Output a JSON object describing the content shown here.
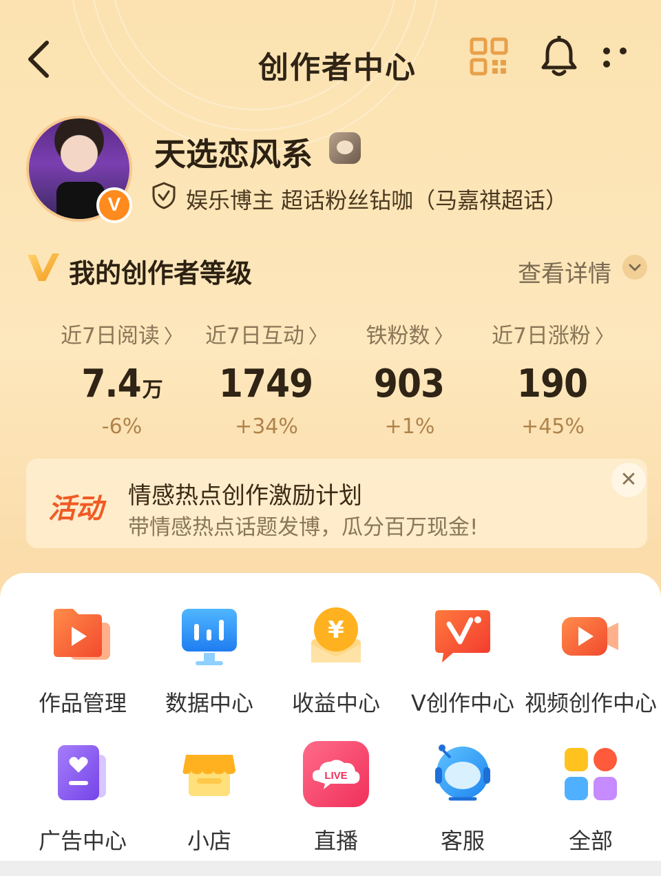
{
  "header": {
    "title": "创作者中心",
    "back_icon": "chevron-left-icon",
    "qr_icon": "qr-code-icon",
    "bell_icon": "bell-icon",
    "more_icon": "more-dots-icon"
  },
  "profile": {
    "name": "天选恋风系",
    "verified_badge": "V",
    "verify_text": "娱乐博主 超话粉丝钻咖（马嘉祺超话）"
  },
  "level": {
    "title": "我的创作者等级",
    "detail_link": "查看详情"
  },
  "stats": [
    {
      "label": "近7日阅读",
      "value": "7.4",
      "unit": "万",
      "change": "-6%"
    },
    {
      "label": "近7日互动",
      "value": "1749",
      "unit": "",
      "change": "+34%"
    },
    {
      "label": "铁粉数",
      "value": "903",
      "unit": "",
      "change": "+1%"
    },
    {
      "label": "近7日涨粉",
      "value": "190",
      "unit": "",
      "change": "+45%"
    }
  ],
  "banner": {
    "tag": "活动",
    "title": "情感热点创作激励计划",
    "subtitle": "带情感热点话题发博，瓜分百万现金!",
    "close": "✕"
  },
  "tools": [
    {
      "label": "作品管理",
      "icon": "works-folder-icon"
    },
    {
      "label": "数据中心",
      "icon": "data-chart-icon"
    },
    {
      "label": "收益中心",
      "icon": "yen-coin-icon"
    },
    {
      "label": "V创作中心",
      "icon": "v-create-icon"
    },
    {
      "label": "视频创作中心",
      "icon": "video-camera-icon"
    },
    {
      "label": "广告中心",
      "icon": "ad-book-icon"
    },
    {
      "label": "小店",
      "icon": "shop-icon"
    },
    {
      "label": "直播",
      "icon": "live-icon"
    },
    {
      "label": "客服",
      "icon": "customer-service-icon"
    },
    {
      "label": "全部",
      "icon": "all-grid-icon"
    }
  ],
  "tool_extra": {
    "yen_symbol": "¥",
    "live_text": "LIVE"
  },
  "colors": {
    "background": "#fbe2b0",
    "accent_orange": "#ff8a1e",
    "banner_tag": "#f05a24"
  }
}
